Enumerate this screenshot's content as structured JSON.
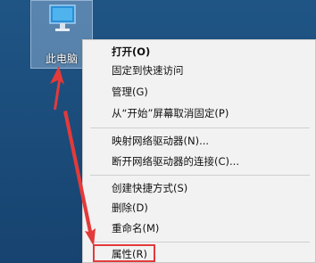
{
  "desktop": {
    "icon_name": "pc-monitor-icon",
    "icon_label": "此电脑"
  },
  "menu": {
    "items": [
      {
        "label": "打开(O)",
        "bold": true
      },
      {
        "label": "固定到快速访问"
      },
      {
        "label": "管理(G)"
      },
      {
        "label": "从“开始”屏幕取消固定(P)"
      },
      {
        "label": "映射网络驱动器(N)..."
      },
      {
        "label": "断开网络驱动器的连接(C)..."
      },
      {
        "label": "创建快捷方式(S)"
      },
      {
        "label": "删除(D)"
      },
      {
        "label": "重命名(M)"
      },
      {
        "label": "属性(R)"
      }
    ]
  },
  "annotation": {
    "arrow_color": "#e33a3a",
    "highlight_color": "#e33a3a"
  }
}
